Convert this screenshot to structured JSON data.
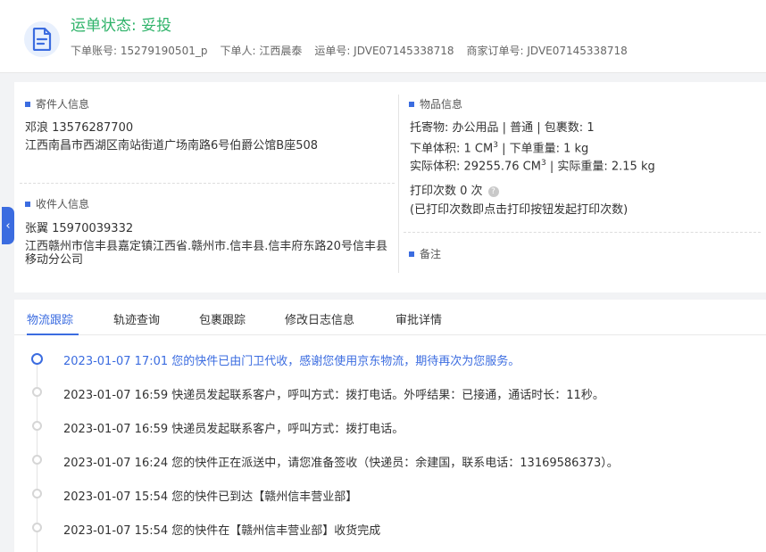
{
  "header": {
    "status": "运单状态: 妥投",
    "account": "下单账号: 15279190501_p",
    "orderer": "下单人: 江西晨泰",
    "waybill": "运单号: JDVE07145338718",
    "merchant_order": "商家订单号: JDVE07145338718"
  },
  "sender": {
    "title": "寄件人信息",
    "name_phone": "邓浪   13576287700",
    "address": "江西南昌市西湖区南站街道广场南路6号伯爵公馆B座508"
  },
  "receiver": {
    "title": "收件人信息",
    "name_phone": "张翼   15970039332",
    "address": "江西赣州市信丰县嘉定镇江西省.赣州市.信丰县.信丰府东路20号信丰县移动分公司"
  },
  "goods": {
    "title": "物品信息",
    "line1": "托寄物: 办公用品 | 普通  |  包裹数:  1",
    "volume_label": "下单体积:  1 CM",
    "volume_sup": "3",
    "weight": " |  下单重量:  1 kg",
    "actual_volume_label": "实际体积:  29255.76 CM",
    "actual_volume_sup": "3",
    "actual_weight": " |  实际重量:  2.15 kg",
    "print_count": "打印次数   0 次",
    "print_help": "?",
    "print_note": "(已打印次数即点击打印按钮发起打印次数)"
  },
  "remark": {
    "title": "备注"
  },
  "side_tab_icon": "‹",
  "tabs": [
    "物流跟踪",
    "轨迹查询",
    "包裹跟踪",
    "修改日志信息",
    "审批详情"
  ],
  "timeline": [
    {
      "text": "2023-01-07 17:01 您的快件已由门卫代收，感谢您使用京东物流，期待再次为您服务。",
      "active": true
    },
    {
      "text": "2023-01-07 16:59 快递员发起联系客户，呼叫方式：拨打电话。外呼结果：已接通，通话时长：11秒。",
      "active": false
    },
    {
      "text": "2023-01-07 16:59 快递员发起联系客户，呼叫方式：拨打电话。",
      "active": false
    },
    {
      "text": "2023-01-07 16:24 您的快件正在派送中，请您准备签收（快递员：余建国，联系电话：13169586373）。",
      "active": false
    },
    {
      "text": "2023-01-07 15:54 您的快件已到达【赣州信丰营业部】",
      "active": false
    },
    {
      "text": "2023-01-07 15:54 您的快件在【赣州信丰营业部】收货完成",
      "active": false
    }
  ],
  "colors": {
    "accent": "#3b6ce0",
    "status": "#2fb36a"
  }
}
